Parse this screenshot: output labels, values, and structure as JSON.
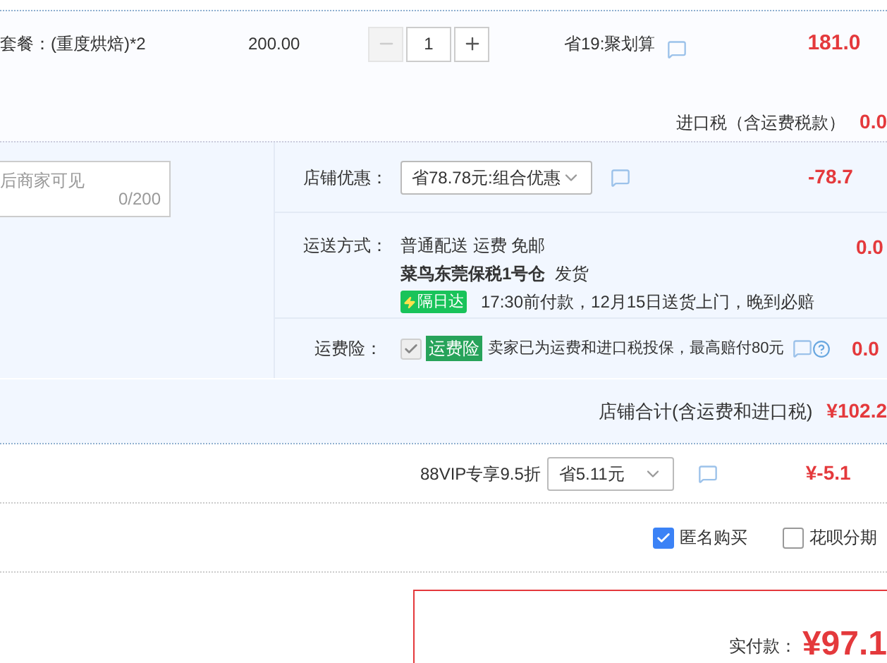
{
  "item": {
    "name": "套餐：(重度烘焙)*2",
    "price": "200.00",
    "quantity": "1",
    "minus_disabled": true,
    "promo": "省19:聚划算",
    "subtotal": "181.0"
  },
  "import_tax": {
    "label": "进口税（含运费税款）",
    "value": "0.0"
  },
  "message": {
    "placeholder": "后商家可见",
    "count": "0/200"
  },
  "shop_discount": {
    "label": "店铺优惠：",
    "option": "省78.78元:组合优惠",
    "value": "-78.7"
  },
  "shipping": {
    "label": "运送方式：",
    "method": "普通配送 运费 免邮",
    "warehouse": "**菜鸟东莞保税1号仓**  发货",
    "badge": "隔日达",
    "promise": "17:30前付款，12月15日送货上门，晚到必赔",
    "value": "0.0"
  },
  "insurance": {
    "label": "运费险：",
    "checked": true,
    "disabled": true,
    "tag": "运费险",
    "text": "卖家已为运费和进口税投保，最高赔付80元",
    "value": "0.0"
  },
  "shop_total": {
    "label": "店铺合计(含运费和进口税)",
    "value": "¥102.2"
  },
  "vip": {
    "label": "88VIP专享9.5折",
    "option": "省5.11元",
    "value": "¥-5.1"
  },
  "options": [
    {
      "label": "匿名购买",
      "checked": true
    },
    {
      "label": "花呗分期",
      "checked": false
    }
  ],
  "payment": {
    "label": "实付款：",
    "value": "¥97.1"
  }
}
